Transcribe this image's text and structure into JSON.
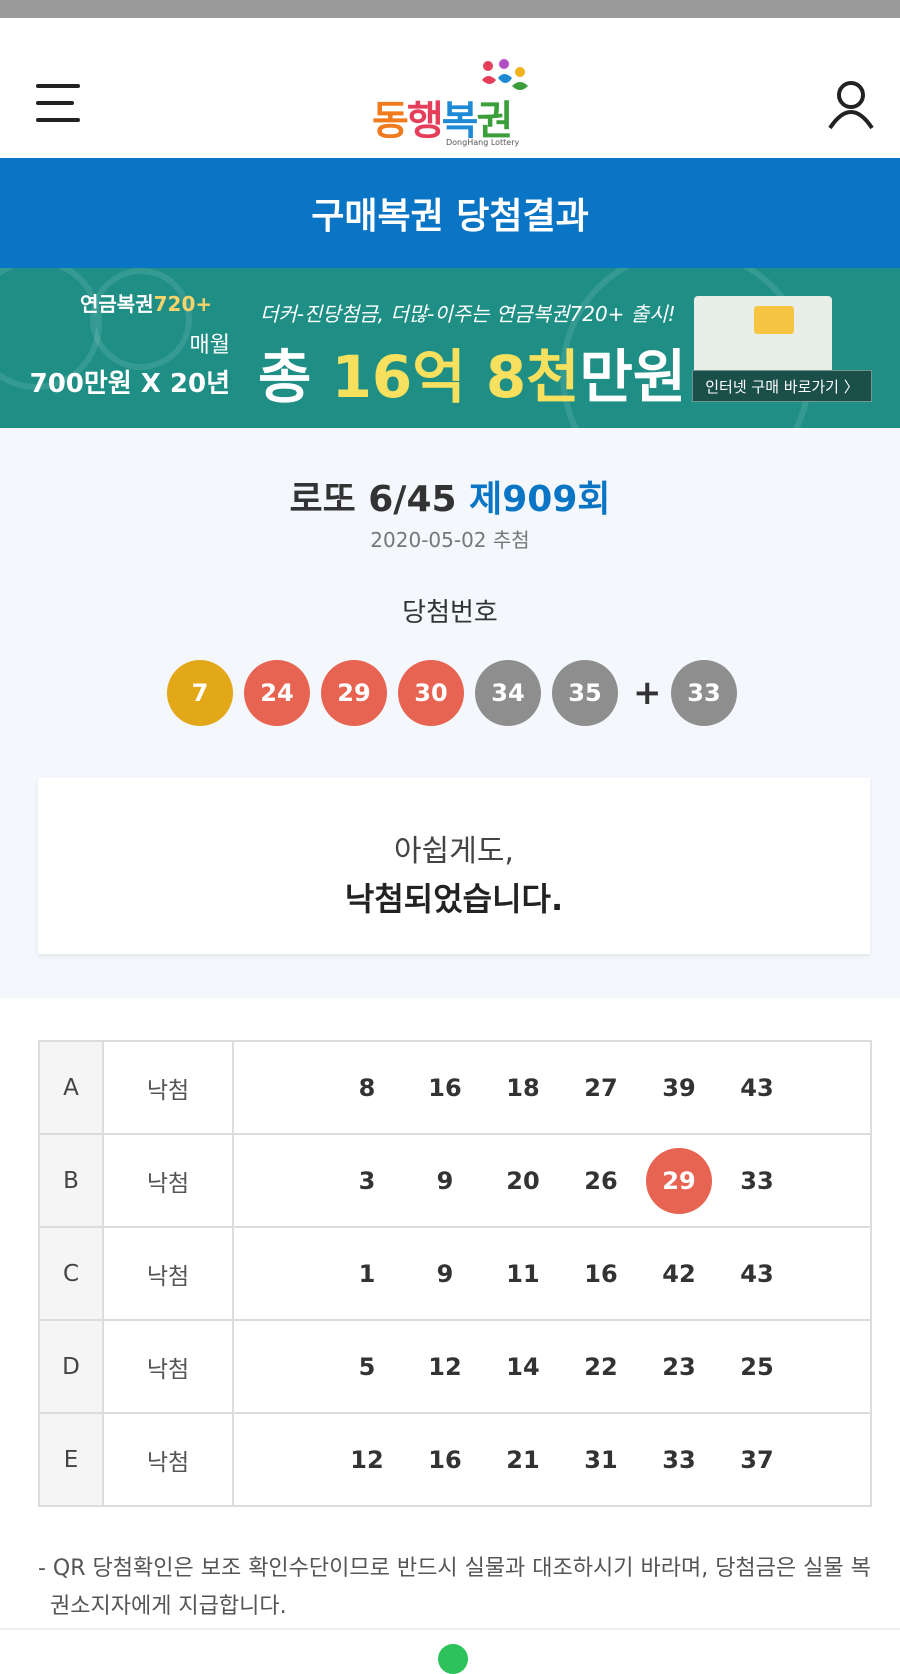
{
  "header": {
    "logo": {
      "text_a": "동",
      "text_b": "행",
      "text_c": "복",
      "text_d": "권",
      "subtitle": "DongHang Lottery"
    },
    "menu_icon": "hamburger-menu-icon",
    "user_icon": "user-icon"
  },
  "title_bar": {
    "title": "구매복권 당첨결과"
  },
  "banner": {
    "brand_prefix": "연금복권",
    "brand_number": "720+",
    "monthly": "매월",
    "amount": "700만원 X 20년",
    "tagline": "더커-진당첨금, 더많-이주는 연금복권720+ 출시!",
    "total_prefix": "총 ",
    "total_highlight": "16억 8천",
    "total_suffix": "만원",
    "link_label": "인터넷 구매 바로가기 〉"
  },
  "draw": {
    "game": "로또 6/45",
    "round": "제909회",
    "date": "2020-05-02 추첨",
    "winning_label": "당첨번호",
    "numbers": [
      {
        "value": "7",
        "color": "#e2a818"
      },
      {
        "value": "24",
        "color": "#e86452"
      },
      {
        "value": "29",
        "color": "#e86452"
      },
      {
        "value": "30",
        "color": "#e86452"
      },
      {
        "value": "34",
        "color": "#8e8e8e"
      },
      {
        "value": "35",
        "color": "#8e8e8e"
      }
    ],
    "plus": "+",
    "bonus": {
      "value": "33",
      "color": "#8e8e8e"
    }
  },
  "message": {
    "line1": "아쉽게도,",
    "line2": "낙첨되었습니다."
  },
  "tickets": [
    {
      "label": "A",
      "result": "낙첨",
      "numbers": [
        "8",
        "16",
        "18",
        "27",
        "39",
        "43"
      ],
      "hits": []
    },
    {
      "label": "B",
      "result": "낙첨",
      "numbers": [
        "3",
        "9",
        "20",
        "26",
        "29",
        "33"
      ],
      "hits": [
        4
      ]
    },
    {
      "label": "C",
      "result": "낙첨",
      "numbers": [
        "1",
        "9",
        "11",
        "16",
        "42",
        "43"
      ],
      "hits": []
    },
    {
      "label": "D",
      "result": "낙첨",
      "numbers": [
        "5",
        "12",
        "14",
        "22",
        "23",
        "25"
      ],
      "hits": []
    },
    {
      "label": "E",
      "result": "낙첨",
      "numbers": [
        "12",
        "16",
        "21",
        "31",
        "33",
        "37"
      ],
      "hits": []
    }
  ],
  "notice": "- QR 당첨확인은 보조 확인수단이므로 반드시 실물과 대조하시기 바라며, 당첨금은 실물 복권소지자에게 지급합니다.",
  "colors": {
    "brand_blue": "#0a74c5",
    "hit_red": "#e86452",
    "banner_teal": "#1f8f86"
  }
}
